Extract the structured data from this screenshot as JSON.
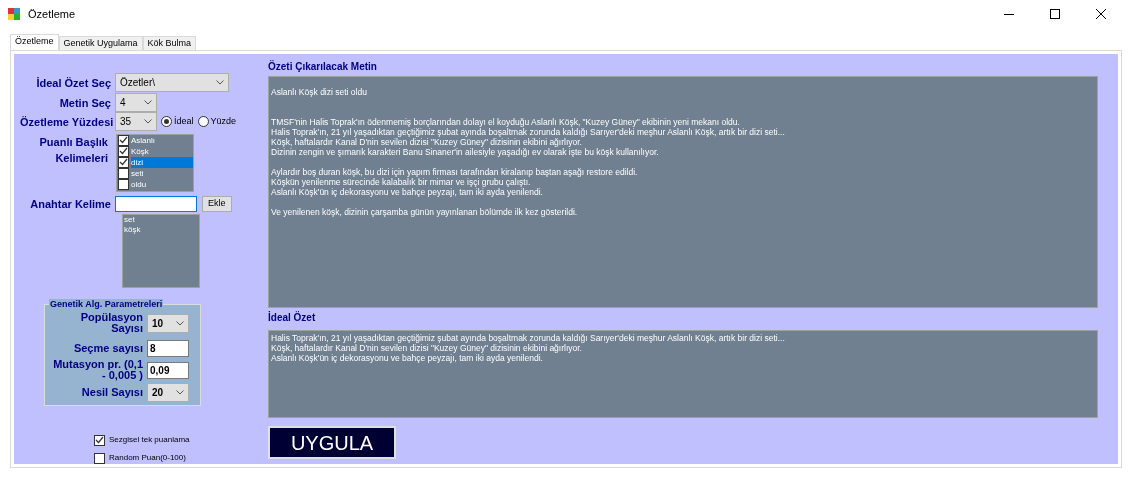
{
  "window": {
    "title": "Özetleme"
  },
  "tabs": [
    {
      "label": "Özetleme",
      "selected": true
    },
    {
      "label": "Genetik Uygulama",
      "selected": false
    },
    {
      "label": "Kök Bulma",
      "selected": false
    }
  ],
  "ideal_ozet_sec": {
    "label": "İdeal Özet Seç",
    "value": "Özetler\\"
  },
  "metin_sec": {
    "label": "Metin Seç",
    "value": "4"
  },
  "ozetleme_yuzdesi": {
    "label": "Özetleme Yüzdesi",
    "value": "35",
    "options": [
      {
        "label": "İdeal",
        "selected": true
      },
      {
        "label": "Yüzde",
        "selected": false
      }
    ]
  },
  "puanli_baslik": {
    "label": "Puanlı Başlık Kelimeleri",
    "items": [
      {
        "label": "Aslanlı",
        "checked": true,
        "selected": false
      },
      {
        "label": "Köşk",
        "checked": true,
        "selected": false
      },
      {
        "label": "dizi",
        "checked": true,
        "selected": true
      },
      {
        "label": "seti",
        "checked": false,
        "selected": false
      },
      {
        "label": "oldu",
        "checked": false,
        "selected": false
      }
    ]
  },
  "anahtar_kelime": {
    "label": "Anahtar Kelime",
    "button": "Ekle",
    "list": [
      "set",
      "köşk"
    ]
  },
  "genetik": {
    "title": "Genetik Alg. Parametreleri",
    "fields": [
      {
        "kind": "dropdown",
        "label": "Popülasyon Sayısı",
        "value": "10"
      },
      {
        "kind": "input",
        "label": "Seçme sayısı",
        "value": "8"
      },
      {
        "kind": "input",
        "label": "Mutasyon pr. (0,1 - 0,005 )",
        "value": "0,09"
      },
      {
        "kind": "dropdown",
        "label": "Nesil Sayısı",
        "value": "20"
      }
    ]
  },
  "options": [
    {
      "label": "Sezgisel tek puanlama",
      "checked": true
    },
    {
      "label": "Random Puan(0-100)",
      "checked": false
    }
  ],
  "source_text": {
    "title": "Özeti Çıkarılacak Metin",
    "paragraphs": [
      [
        "Aslanlı Köşk dizi seti oldu"
      ],
      [
        "TMSF'nin Halis Toprak'ın ödenmemiş borçlarından dolayı el koyduğu Aslanlı Köşk, \"Kuzey Güney\" ekibinin yeni mekanı oldu.",
        "Halis Toprak'ın, 21 yıl yaşadıktan geçtiğimiz şubat ayında boşaltmak zorunda kaldığı Sarıyer'deki meşhur Aslanlı Köşk, artık bir dizi seti...",
        "Köşk, haftalardır Kanal D'nin sevilen dizisi \"Kuzey Güney\" dizisinin ekibini ağırlıyor.",
        "Dizinin zengin ve şımarık karakteri Banu Sinaner'in ailesiyle yaşadığı ev olarak işte bu köşk kullanılıyor."
      ],
      [
        "Aylardır boş duran köşk, bu dizi için yapım firması tarafından kiralanıp baştan aşağı restore edildi.",
        "Köşkün yenilenme sürecinde kalabalık bir mimar ve işçi grubu çalıştı.",
        "Aslanlı Köşk'ün iç dekorasyonu ve bahçe peyzajı, tam iki ayda yenilendi."
      ],
      [
        "Ve yenilenen köşk,  dizinin çarşamba günün yayınlanan bölümde ilk kez gösterildi."
      ]
    ]
  },
  "ideal_summary": {
    "title": "İdeal Özet",
    "lines": [
      "Halis Toprak'ın, 21 yıl yaşadıktan geçtiğimiz şubat ayında boşaltmak zorunda kaldığı Sarıyer'deki meşhur Aslanlı Köşk, artık bir dizi seti...",
      "Köşk, haftalardır Kanal D'nin sevilen dizisi \"Kuzey Güney\" dizisinin ekibini ağırlıyor.",
      "Aslanlı Köşk'ün iç dekorasyonu ve bahçe peyzajı, tam iki ayda yenilendi."
    ]
  },
  "apply_button": "UYGULA"
}
